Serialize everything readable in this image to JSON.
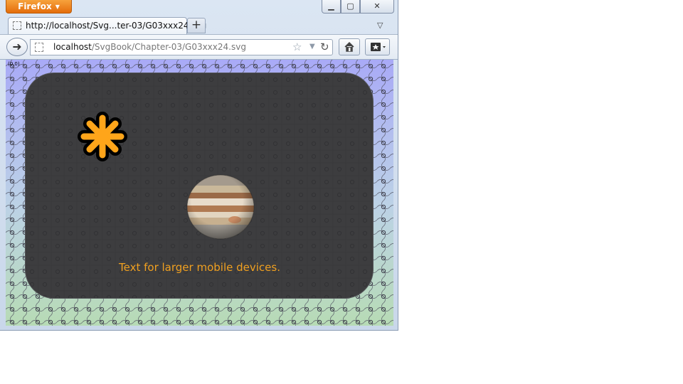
{
  "browser": {
    "menu_button": "Firefox",
    "tab": {
      "title": "http://localhost/Svg...ter-03/G03xxx24.svg"
    },
    "newtab_symbol": "+",
    "url": {
      "host": "localhost",
      "path": "/SvgBook/Chapter-03/G03xxx24.svg"
    },
    "icons": {
      "back": "back-arrow-icon",
      "star": "bookmark-star-icon",
      "reload": "reload-icon",
      "home": "home-icon",
      "bookmarks": "bookmarks-menu-icon",
      "minimize": "minimize-icon",
      "maximize": "maximize-icon",
      "close": "close-icon"
    }
  },
  "content": {
    "origin_label": "(0,0)",
    "caption": "Text for larger mobile devices.",
    "colors": {
      "panel": "#3d3d3f",
      "caption": "#f0a020",
      "star_fill": "#ffa51a",
      "background_top": "#a9aaf7",
      "background_bottom": "#b7dbb5"
    }
  }
}
